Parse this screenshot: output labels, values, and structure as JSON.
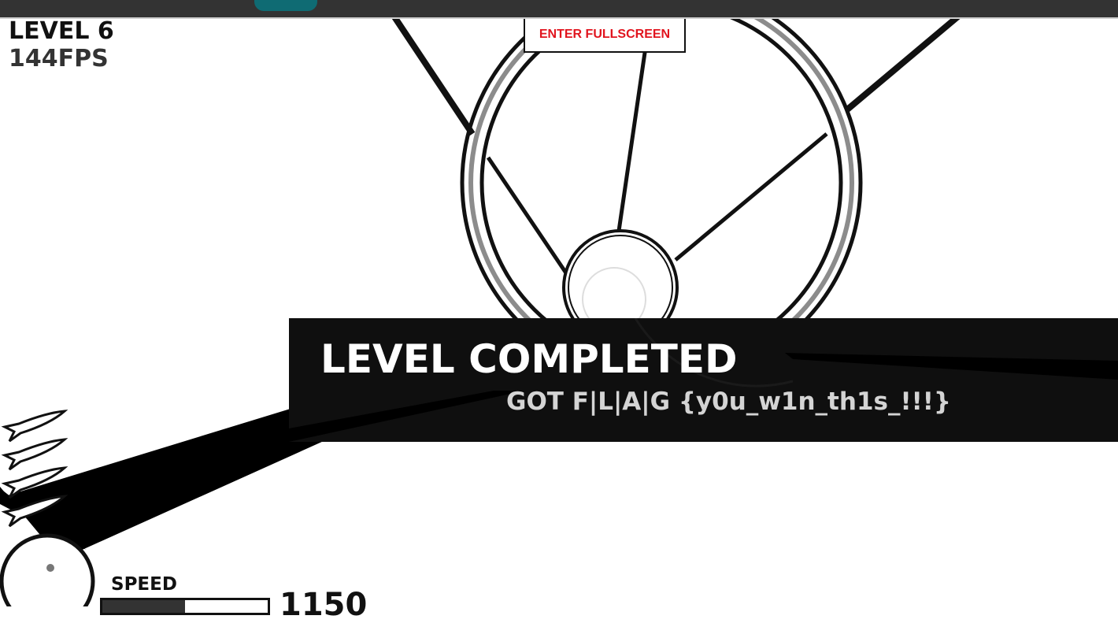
{
  "hud": {
    "level": "LEVEL 6",
    "fps": "144FPS"
  },
  "fullscreen_button": {
    "label": "ENTER FULLSCREEN"
  },
  "banner": {
    "title": "LEVEL COMPLETED",
    "message": "GOT F|L|A|G {y0u_w1n_th1s_!!!}"
  },
  "speed": {
    "label": "SPEED",
    "value": "1150",
    "fill_fraction": 0.5
  },
  "rockets_remaining": 4,
  "colors": {
    "browser_bar": "#333333",
    "browser_tab": "#0f6b73",
    "fullscreen_text": "#e1141e",
    "banner_bg": "#0f0f0f",
    "ink": "#111111"
  },
  "icons": {
    "rocket": "rocket-icon",
    "launcher": "launcher-circle"
  }
}
